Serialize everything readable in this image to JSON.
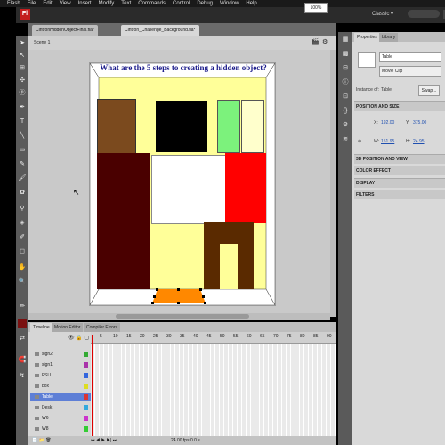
{
  "menubar": {
    "items": [
      "Flash",
      "File",
      "Edit",
      "View",
      "Insert",
      "Modify",
      "Text",
      "Commands",
      "Control",
      "Debug",
      "Window",
      "Help"
    ]
  },
  "app": {
    "logo": "Fl",
    "workspace": "Classic ▾"
  },
  "doc_tabs": [
    "CintronHiddenObjectFinal.fla*",
    "Cintron_Challenge_Background.fla*"
  ],
  "editbar": {
    "scene": "Scene 1",
    "zoom": "100%"
  },
  "stage": {
    "title": "What are the 5 steps to creating a hidden object?",
    "colors": {
      "bg": "#ffff99",
      "wood": "#7b4a1e",
      "black": "#000000",
      "green": "#7cf27c",
      "cream": "#ffffcc",
      "maroon": "#4a0000",
      "white": "#ffffff",
      "red": "#ff0000",
      "brown": "#5a2a00",
      "orange": "#ff8800"
    }
  },
  "timeline": {
    "tabs": [
      "Timeline",
      "Motion Editor",
      "Compiler Errors"
    ],
    "frame_numbers": [
      "5",
      "10",
      "15",
      "20",
      "25",
      "30",
      "35",
      "40",
      "45",
      "50",
      "55",
      "60",
      "65",
      "70",
      "75",
      "80",
      "85",
      "90"
    ],
    "layers": [
      {
        "name": "sign2",
        "color": "#33aa33"
      },
      {
        "name": "sign1",
        "color": "#aa33aa"
      },
      {
        "name": "FSU",
        "color": "#3366dd"
      },
      {
        "name": "box",
        "color": "#dddd22"
      },
      {
        "name": "Table",
        "color": "#dd3333",
        "selected": true
      },
      {
        "name": "Desk",
        "color": "#33aadd"
      },
      {
        "name": "W6",
        "color": "#cc33cc"
      },
      {
        "name": "W8",
        "color": "#33cc33"
      }
    ],
    "footer": "24.00 fps   0.0 s"
  },
  "properties": {
    "tabs": [
      "Properties",
      "Library"
    ],
    "instance_name": "Table",
    "symbol_type": "Movie Clip",
    "instance_of_label": "Instance of:",
    "instance_of": "Table",
    "swap_label": "Swap...",
    "sections": {
      "position": "POSITION AND SIZE",
      "pos3d": "3D POSITION AND VIEW",
      "color": "COLOR EFFECT",
      "display": "DISPLAY",
      "filters": "FILTERS"
    },
    "x_label": "X:",
    "x": "192.00",
    "y_label": "Y:",
    "y": "375.00",
    "w_label": "W:",
    "w": "151.95",
    "h_label": "H:",
    "h": "24.95"
  }
}
